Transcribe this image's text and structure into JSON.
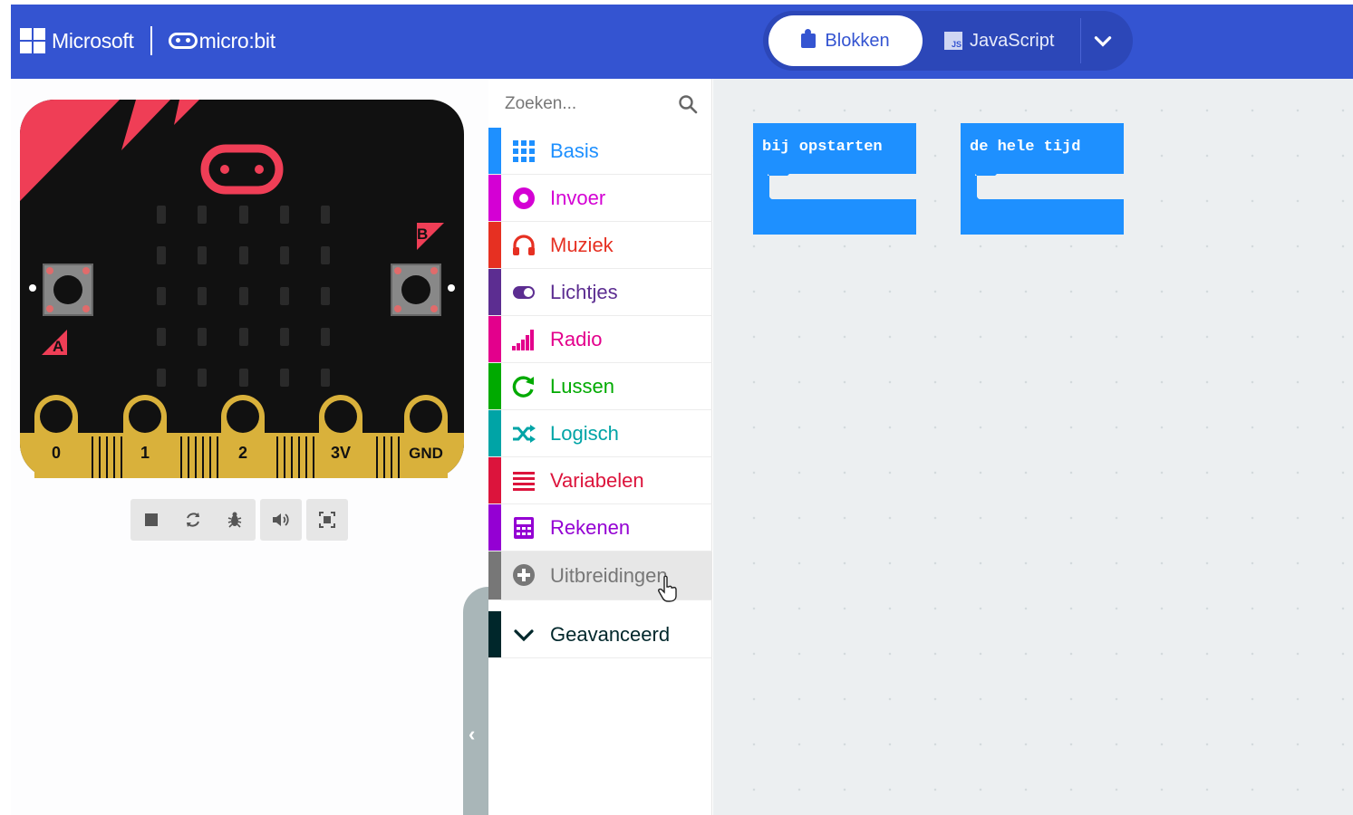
{
  "header": {
    "brand_microsoft": "Microsoft",
    "brand_microbit": "micro:bit",
    "tab_blocks": "Blokken",
    "tab_javascript": "JavaScript",
    "js_icon_text": "JS",
    "colors": {
      "header_bg": "#3454d1",
      "active_tab_text": "#3454d1"
    }
  },
  "simulator": {
    "pins": [
      "0",
      "1",
      "2",
      "3V",
      "GND"
    ],
    "button_a": "A",
    "button_b": "B",
    "controls": [
      "stop-icon",
      "restart-icon",
      "debug-icon",
      "sound-icon",
      "fullscreen-icon"
    ]
  },
  "toolbox": {
    "search_placeholder": "Zoeken...",
    "categories": [
      {
        "label": "Basis",
        "color": "#1e90ff",
        "icon": "grid-icon"
      },
      {
        "label": "Invoer",
        "color": "#d400d4",
        "icon": "target-icon"
      },
      {
        "label": "Muziek",
        "color": "#e63022",
        "icon": "headphones-icon"
      },
      {
        "label": "Lichtjes",
        "color": "#5c2d91",
        "icon": "toggle-icon"
      },
      {
        "label": "Radio",
        "color": "#e3008c",
        "icon": "signal-icon"
      },
      {
        "label": "Lussen",
        "color": "#00aa00",
        "icon": "refresh-icon"
      },
      {
        "label": "Logisch",
        "color": "#00a4a6",
        "icon": "shuffle-icon"
      },
      {
        "label": "Variabelen",
        "color": "#dc143c",
        "icon": "list-icon"
      },
      {
        "label": "Rekenen",
        "color": "#9400d3",
        "icon": "calculator-icon"
      },
      {
        "label": "Uitbreidingen",
        "color": "#777777",
        "icon": "plus-circle-icon"
      },
      {
        "label": "Geavanceerd",
        "color": "#00272b",
        "icon": "chevron-down-icon"
      }
    ]
  },
  "workspace": {
    "blocks": [
      {
        "label": "bij opstarten",
        "color": "#1e90ff"
      },
      {
        "label": "de hele tijd",
        "color": "#1e90ff"
      }
    ]
  }
}
